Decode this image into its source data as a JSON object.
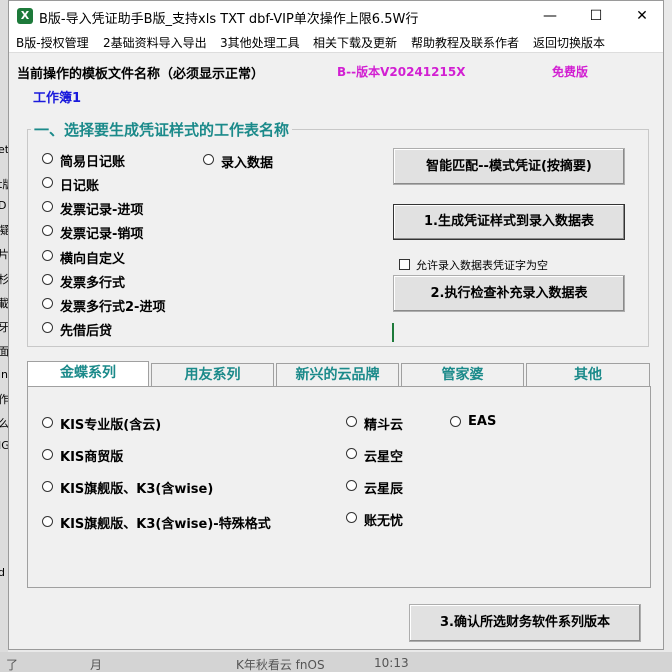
{
  "window": {
    "title": "B版-导入凭证助手B版_支持xls TXT dbf-VIP单次操作上限6.5W行",
    "app_icon": "excel-x-icon",
    "minimize_glyph": "—",
    "maximize_glyph": "☐",
    "close_glyph": "✕"
  },
  "menu": [
    "B版-授权管理",
    "2基础资料导入导出",
    "3其他处理工具",
    "相关下载及更新",
    "帮助教程及联系作者",
    "返回切换版本"
  ],
  "header": {
    "template_label": "当前操作的模板文件名称（必须显示正常）",
    "version": "B--版本V20241215X",
    "license": "免费版",
    "workbook": "工作簿1"
  },
  "colors": {
    "teal": "#1b8a8a",
    "magenta": "#d21fd2",
    "blue": "#1a1adc",
    "green": "#1d7a3a"
  },
  "sheet_group": {
    "title": "一、选择要生成凭证样式的工作表名称",
    "options_left": [
      "简易日记账",
      "日记账",
      "发票记录-进项",
      "发票记录-销项",
      "横向自定义",
      "发票多行式",
      "发票多行式2-进项",
      "先借后贷"
    ],
    "options_right": [
      "录入数据"
    ],
    "btn_smart_match": "智能匹配--模式凭证(按摘要)",
    "btn_generate": "1.生成凭证样式到录入数据表",
    "allow_empty_label": "允许录入数据表凭证字为空",
    "btn_check": "2.执行检查补充录入数据表"
  },
  "tabs": [
    "金蝶系列",
    "用友系列",
    "新兴的云品牌",
    "管家婆",
    "其他"
  ],
  "kingdee": {
    "col1": [
      "KIS专业版(含云)",
      "KIS商贸版",
      "KIS旗舰版、K3(含wise)",
      "KIS旗舰版、K3(含wise)-特殊格式"
    ],
    "col2": [
      "精斗云",
      "云星空",
      "云星辰",
      "账无忧"
    ],
    "col3": [
      "EAS"
    ]
  },
  "btn_confirm": "3.确认所选财务软件系列版本",
  "background": {
    "left_glyphs": [
      "et",
      "t版",
      "D",
      "凝",
      "片",
      "杉",
      "載",
      "牙",
      "面",
      "in",
      "作",
      "么",
      "IG",
      "d"
    ],
    "bottom_items": [
      "了",
      "月",
      "K年秋看云 fnOS",
      "10:13"
    ]
  }
}
